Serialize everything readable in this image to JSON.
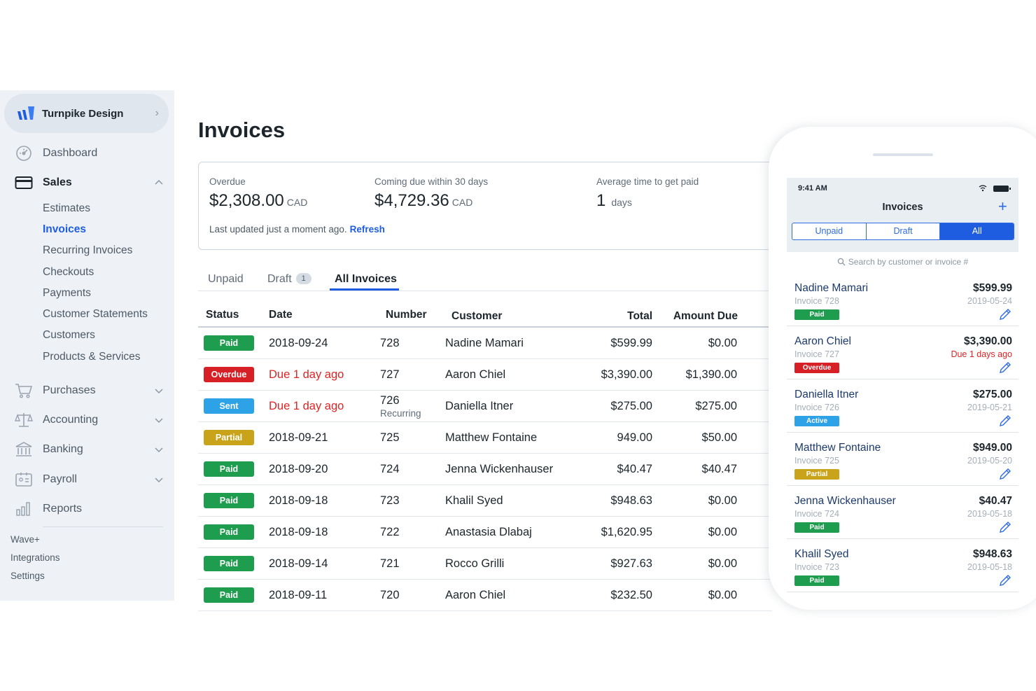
{
  "colors": {
    "accent": "#1f5de0",
    "paid": "#1f9d4f",
    "overdue": "#d71f26",
    "sent": "#2ea2e6",
    "partial": "#c9a319",
    "due_red": "#e02424"
  },
  "sidebar": {
    "business_name": "Turnpike Design",
    "nav": [
      {
        "label": "Dashboard",
        "icon": "dashboard-icon"
      },
      {
        "label": "Sales",
        "icon": "sales-card-icon"
      },
      {
        "label": "Purchases",
        "icon": "cart-icon"
      },
      {
        "label": "Accounting",
        "icon": "scales-icon"
      },
      {
        "label": "Banking",
        "icon": "bank-icon"
      },
      {
        "label": "Payroll",
        "icon": "payroll-icon"
      },
      {
        "label": "Reports",
        "icon": "bar-chart-icon"
      }
    ],
    "sales_sub": [
      "Estimates",
      "Invoices",
      "Recurring Invoices",
      "Checkouts",
      "Payments",
      "Customer Statements",
      "Customers",
      "Products & Services"
    ],
    "footer": [
      "Wave+",
      "Integrations",
      "Settings"
    ]
  },
  "main": {
    "title": "Invoices",
    "summary": {
      "overdue_label": "Overdue",
      "overdue_value": "$2,308.00",
      "coming_label": "Coming due within 30 days",
      "coming_value": "$4,729.36",
      "avg_label": "Average time to get paid",
      "avg_value": "1",
      "avg_unit": "days",
      "currency": "CAD",
      "updated": "Last updated just a moment ago.",
      "refresh": "Refresh"
    },
    "tabs": {
      "unpaid": "Unpaid",
      "draft": "Draft",
      "draft_count": "1",
      "all": "All Invoices"
    },
    "columns": {
      "status": "Status",
      "date": "Date",
      "number": "Number",
      "customer": "Customer",
      "total": "Total",
      "amount_due": "Amount Due"
    },
    "rows": [
      {
        "status": "Paid",
        "date": "2018-09-24",
        "number": "728",
        "customer": "Nadine Mamari",
        "total": "$599.99",
        "due": "$0.00"
      },
      {
        "status": "Overdue",
        "date": "Due 1 day ago",
        "number": "727",
        "customer": "Aaron Chiel",
        "total": "$3,390.00",
        "due": "$1,390.00"
      },
      {
        "status": "Sent",
        "date": "Due 1 day ago",
        "number": "726",
        "sub": "Recurring",
        "customer": "Daniella Itner",
        "total": "$275.00",
        "due": "$275.00"
      },
      {
        "status": "Partial",
        "date": "2018-09-21",
        "number": "725",
        "customer": "Matthew Fontaine",
        "total": "949.00",
        "due": "$50.00"
      },
      {
        "status": "Paid",
        "date": "2018-09-20",
        "number": "724",
        "customer": "Jenna Wickenhauser",
        "total": "$40.47",
        "due": "$40.47"
      },
      {
        "status": "Paid",
        "date": "2018-09-18",
        "number": "723",
        "customer": "Khalil Syed",
        "total": "$948.63",
        "due": "$0.00"
      },
      {
        "status": "Paid",
        "date": "2018-09-18",
        "number": "722",
        "customer": "Anastasia Dlabaj",
        "total": "$1,620.95",
        "due": "$0.00"
      },
      {
        "status": "Paid",
        "date": "2018-09-14",
        "number": "721",
        "customer": "Rocco Grilli",
        "total": "$927.63",
        "due": "$0.00"
      },
      {
        "status": "Paid",
        "date": "2018-09-11",
        "number": "720",
        "customer": "Aaron Chiel",
        "total": "$232.50",
        "due": "$0.00"
      }
    ]
  },
  "mobile": {
    "time": "9:41 AM",
    "title": "Invoices",
    "segments": [
      "Unpaid",
      "Draft",
      "All"
    ],
    "search_placeholder": "Search by customer or invoice #",
    "items": [
      {
        "name": "Nadine Mamari",
        "amount": "$599.99",
        "invoice": "Invoice 728",
        "date": "2019-05-24",
        "status": "Paid"
      },
      {
        "name": "Aaron Chiel",
        "amount": "$3,390.00",
        "invoice": "Invoice 727",
        "date": "Due 1 days ago",
        "status": "Overdue"
      },
      {
        "name": "Daniella Itner",
        "amount": "$275.00",
        "invoice": "Invoice 726",
        "date": "2019-05-21",
        "status": "Active"
      },
      {
        "name": "Matthew Fontaine",
        "amount": "$949.00",
        "invoice": "Invoice 725",
        "date": "2019-05-20",
        "status": "Partial"
      },
      {
        "name": "Jenna Wickenhauser",
        "amount": "$40.47",
        "invoice": "Invoice 724",
        "date": "2019-05-18",
        "status": "Paid"
      },
      {
        "name": "Khalil Syed",
        "amount": "$948.63",
        "invoice": "Invoice 723",
        "date": "2019-05-18",
        "status": "Paid"
      }
    ]
  }
}
